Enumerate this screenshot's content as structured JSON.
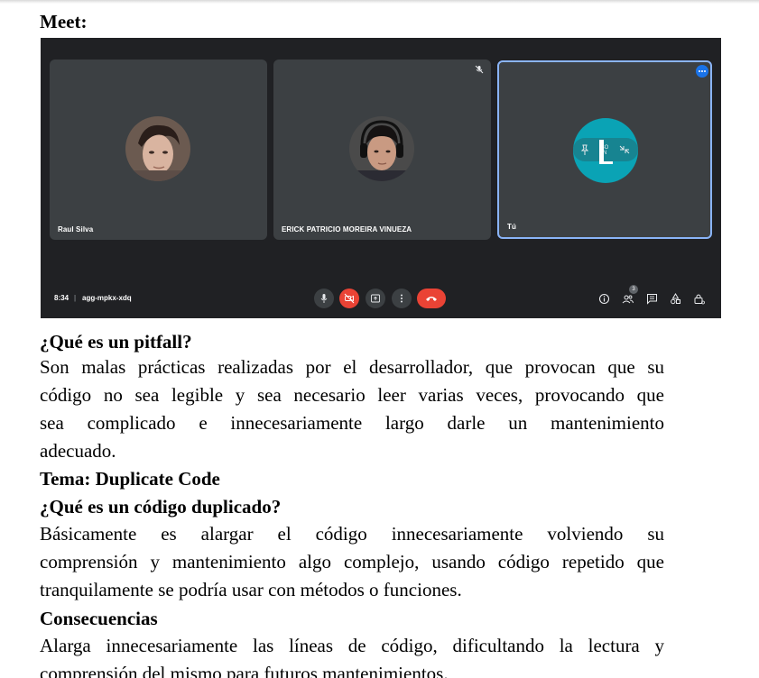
{
  "headings": {
    "meet": "Meet:",
    "pitfall_question": "¿Qué es un pitfall?",
    "tema": "Tema: Duplicate Code",
    "duplicado_question": "¿Qué es un código duplicado?",
    "consecuencias": "Consecuencias"
  },
  "paragraphs": {
    "pitfall_lines": [
      "Son malas prácticas realizadas por el desarrollador, que provocan que su",
      "código no sea legible y sea necesario leer varias veces, provocando que",
      "sea complicado e innecesariamente largo darle un mantenimiento",
      "adecuado."
    ],
    "duplicado_lines": [
      "Básicamente es alargar el código innecesariamente volviendo su",
      "comprensión y mantenimiento algo complejo, usando código repetido que",
      "tranquilamente se podría usar con métodos o funciones."
    ],
    "consecuencias_lines": [
      "Alarga innecesariamente las líneas de código, dificultando la lectura y",
      "comprensión del mismo para futuros mantenimientos."
    ]
  },
  "meet": {
    "participants": [
      {
        "name": "Raul Silva"
      },
      {
        "name": "ERICK PATRICIO MOREIRA VINUEZA"
      },
      {
        "name": "Tú"
      }
    ],
    "time": "8:34",
    "separator": "|",
    "meeting_code": "agg-mpkx-xdq",
    "people_count": "3",
    "colors": {
      "background": "#202124",
      "tile": "#3c4043",
      "active_border": "#8ab4f8",
      "end_call": "#ea4335",
      "self_avatar": "#0aa3b5"
    },
    "icons": [
      "mic-icon",
      "camera-off-icon",
      "present-icon",
      "more-options-icon",
      "end-call-icon",
      "info-icon",
      "people-icon",
      "chat-icon",
      "activities-icon",
      "host-controls-icon"
    ]
  }
}
